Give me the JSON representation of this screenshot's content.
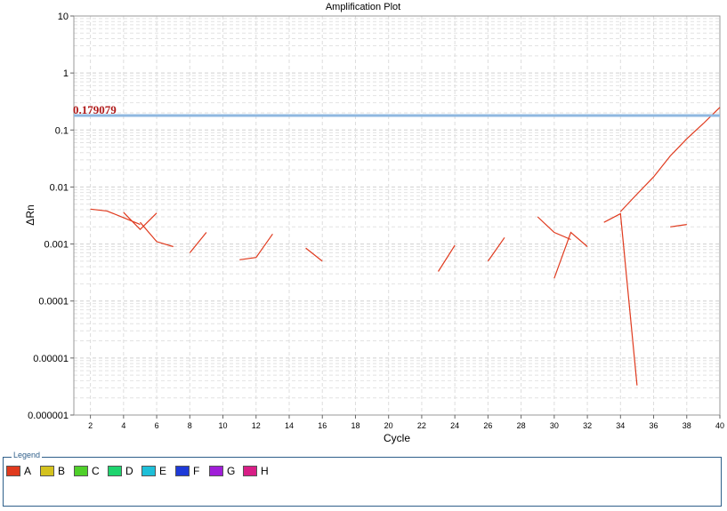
{
  "chart_data": {
    "type": "line",
    "title": "Amplification Plot",
    "xlabel": "Cycle",
    "ylabel": "ΔRn",
    "xlim": [
      1,
      40
    ],
    "ylim": [
      1e-06,
      10
    ],
    "yscale": "log",
    "x_ticks": [
      2,
      4,
      6,
      8,
      10,
      12,
      14,
      16,
      18,
      20,
      22,
      24,
      26,
      28,
      30,
      32,
      34,
      36,
      38,
      40
    ],
    "y_ticks": [
      {
        "value": 10,
        "label": "10"
      },
      {
        "value": 1,
        "label": "1"
      },
      {
        "value": 0.1,
        "label": "0.1"
      },
      {
        "value": 0.01,
        "label": "0.01"
      },
      {
        "value": 0.001,
        "label": "0.001"
      },
      {
        "value": 0.0001,
        "label": "0.0001"
      },
      {
        "value": 1e-05,
        "label": "0.00001"
      },
      {
        "value": 1e-06,
        "label": "0.000001"
      }
    ],
    "grid": true,
    "threshold": {
      "value": 0.179079,
      "label": "0.179079",
      "color": "#8fb8e0"
    },
    "series": [
      {
        "name": "A",
        "color": "#e03a1e",
        "segments": [
          [
            [
              2,
              0.0041
            ],
            [
              3,
              0.0038
            ],
            [
              4,
              0.0029
            ],
            [
              5,
              0.0022
            ]
          ],
          [
            [
              4,
              0.0036
            ],
            [
              5,
              0.0018
            ],
            [
              6,
              0.0035
            ]
          ],
          [
            [
              5,
              0.0024
            ],
            [
              6,
              0.0011
            ],
            [
              7,
              0.0009
            ]
          ],
          [
            [
              8,
              0.0007
            ],
            [
              9,
              0.0016
            ]
          ],
          [
            [
              11,
              0.00053
            ],
            [
              12,
              0.00058
            ],
            [
              13,
              0.0015
            ]
          ],
          [
            [
              15,
              0.00085
            ],
            [
              16,
              0.0005
            ]
          ],
          [
            [
              23,
              0.00033
            ],
            [
              24,
              0.00095
            ]
          ],
          [
            [
              26,
              0.0005
            ],
            [
              27,
              0.0013
            ]
          ],
          [
            [
              29,
              0.003
            ],
            [
              30,
              0.0016
            ],
            [
              31,
              0.0012
            ]
          ],
          [
            [
              30,
              0.00025
            ],
            [
              31,
              0.0016
            ],
            [
              32,
              0.0009
            ]
          ],
          [
            [
              33,
              0.0024
            ],
            [
              34,
              0.0034
            ],
            [
              35,
              3.3e-06
            ]
          ],
          [
            [
              34,
              0.0037
            ],
            [
              35,
              0.0075
            ],
            [
              36,
              0.015
            ],
            [
              37,
              0.035
            ],
            [
              38,
              0.07
            ],
            [
              39,
              0.13
            ],
            [
              40,
              0.25
            ]
          ],
          [
            [
              37,
              0.002
            ],
            [
              38,
              0.0022
            ]
          ]
        ]
      }
    ]
  },
  "legend": {
    "title": "Legend",
    "items": [
      {
        "label": "A",
        "color": "#e03a1e"
      },
      {
        "label": "B",
        "color": "#d4c21e"
      },
      {
        "label": "C",
        "color": "#4fd02a"
      },
      {
        "label": "D",
        "color": "#1ed46e"
      },
      {
        "label": "E",
        "color": "#1ebfd8"
      },
      {
        "label": "F",
        "color": "#1e3ad8"
      },
      {
        "label": "G",
        "color": "#a01ed8"
      },
      {
        "label": "H",
        "color": "#d81e86"
      }
    ]
  }
}
